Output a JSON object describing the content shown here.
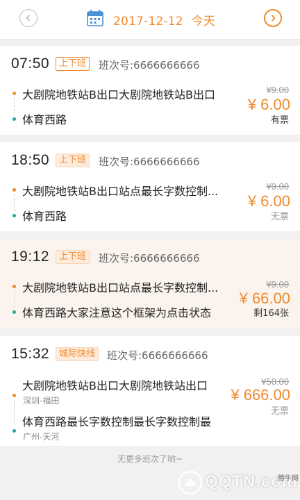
{
  "header": {
    "date": "2017-12-12",
    "day_label": "今天",
    "prev_icon": "chevron-left-icon",
    "next_icon": "chevron-right-icon",
    "calendar_icon": "calendar-icon",
    "colors": {
      "accent": "#f08a2b",
      "muted": "#bdbdbd"
    }
  },
  "trips": [
    {
      "time": "07:50",
      "type": "上下班",
      "bus_no": "班次号:6666666666",
      "from": "大剧院地铁站B出口大剧院地铁站B出口",
      "to": "体育西路",
      "old_price": "¥9.00",
      "price": "¥ 6.00",
      "stock": "有票"
    },
    {
      "time": "18:50",
      "type": "上下班",
      "bus_no": "班次号:6666666666",
      "from": "大剧院地铁站B出口站点最长字数控制...",
      "to": "体育西路",
      "old_price": "¥9.00",
      "price": "¥ 6.00",
      "stock": "无票"
    },
    {
      "time": "19:12",
      "type": "上下班",
      "bus_no": "班次号:6666666666",
      "from": "大剧院地铁站B出口站点最长字数控制...",
      "to": "体育西路大家注意这个框架为点击状态",
      "old_price": "¥9.00",
      "price": "¥ 66.00",
      "stock": "剩164张"
    },
    {
      "time": "15:32",
      "type": "城际快线",
      "bus_no": "班次号:6666666666",
      "from": "大剧院地铁站B出口大剧院地铁站出口",
      "from_area": "深圳-福田",
      "to": "体育西路最长字数控制最长字数控制最",
      "to_area": "广州-天河",
      "old_price": "¥50.00",
      "price": "¥ 666.00",
      "stock": "无票"
    }
  ],
  "footer": {
    "no_more": "无更多班次了哟~"
  },
  "watermark": {
    "text": "QQTN.com",
    "sub": "腾牛网"
  }
}
